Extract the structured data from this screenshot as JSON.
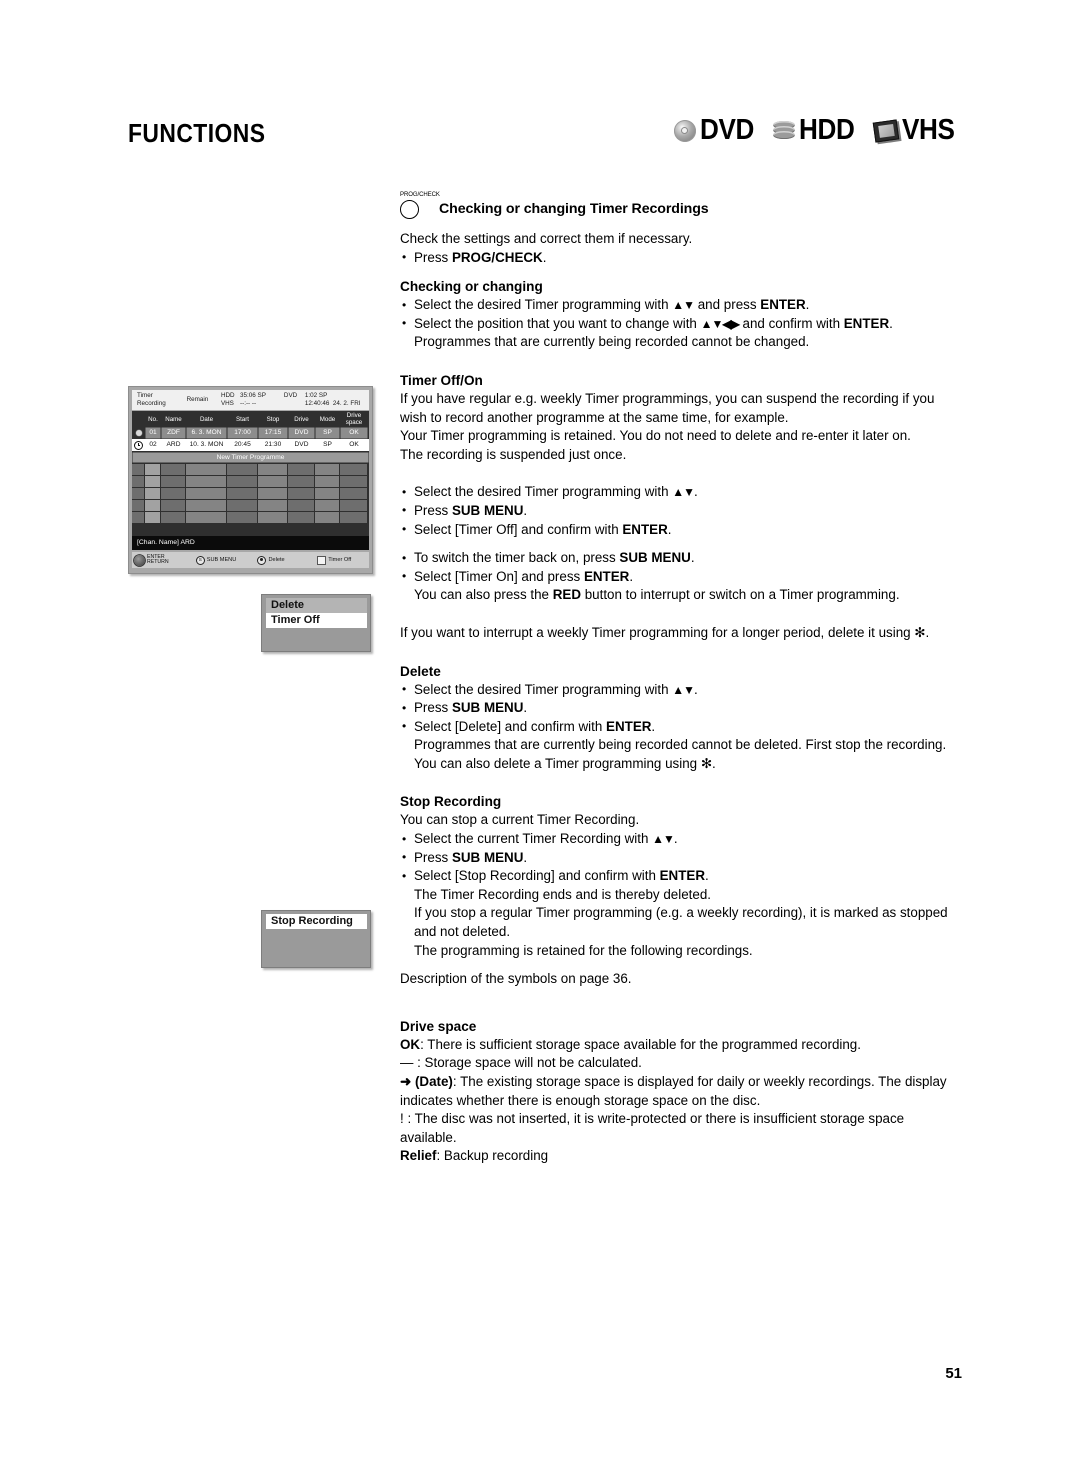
{
  "header": {
    "title": "FUNCTIONS",
    "media_badges": [
      {
        "icon": "disc-icon",
        "label": "DVD"
      },
      {
        "icon": "hdd-icon",
        "label": "HDD"
      },
      {
        "icon": "vhs-cassette-icon",
        "label": "VHS"
      }
    ]
  },
  "figure_timer_screen": {
    "top_bar": {
      "title_line1": "Timer",
      "title_line2": "Recording",
      "remain_label": "Remain",
      "hdd_label": "HDD",
      "hdd_value": "35:06 SP",
      "vhs_label": "VHS",
      "vhs_value": "--:--  --",
      "dvd_label": "DVD",
      "dvd_value": "1:02 SP",
      "clock": "12:40:46",
      "date": "24. 2. FRI"
    },
    "columns": [
      "",
      "No.",
      "Name",
      "Date",
      "Start",
      "Stop",
      "Drive",
      "Mode",
      "Drive space"
    ],
    "column_head_drive_space_line1": "Drive",
    "column_head_drive_space_line2": "space",
    "rows": [
      {
        "mark": "record-dot-icon",
        "no": "01",
        "name": "ZDF",
        "date": "6. 3. MON",
        "start": "17:00",
        "stop": "17:15",
        "drive": "DVD",
        "mode": "SP",
        "drive_space": "OK",
        "state": "selected"
      },
      {
        "mark": "clock-icon",
        "no": "02",
        "name": "ARD",
        "date": "10. 3. MON",
        "start": "20:45",
        "stop": "21:30",
        "drive": "DVD",
        "mode": "SP",
        "drive_space": "OK",
        "state": "normal"
      }
    ],
    "new_timer_programme": "New Timer Programme",
    "chan_name_bar": "[Chan. Name] ARD",
    "footer": {
      "enter": "ENTER",
      "return": "RETURN",
      "sub_menu": "SUB MENU",
      "sub_menu_key": "S",
      "delete": "Delete",
      "timer_off": "Timer Off"
    }
  },
  "popup_sub_menu_1": {
    "items": [
      {
        "label": "Delete",
        "highlight": "gray"
      },
      {
        "label": "Timer Off",
        "highlight": "white"
      }
    ]
  },
  "popup_sub_menu_2": {
    "items": [
      {
        "label": "Stop Recording",
        "highlight": "white"
      }
    ]
  },
  "content": {
    "button_glyph_label": "PROG/CHECK",
    "section_heading": "Checking or changing Timer Recordings",
    "intro_line": "Check the settings and correct them if necessary.",
    "intro_bullet_pre": "Press ",
    "intro_bullet_strong": "PROG/CHECK",
    "intro_bullet_post": ".",
    "checking_or_changing": {
      "heading": "Checking or changing",
      "b1_pre": "Select the desired Timer programming with ",
      "b1_arrows": "▲▼",
      "b1_mid": " and press ",
      "b1_strong": "ENTER",
      "b1_post": ".",
      "b2_pre": "Select the position that you want to change with ",
      "b2_arrows": "▲▼◀▶",
      "b2_mid": " and confirm with ",
      "b2_strong": "ENTER",
      "b2_post": ".",
      "b2_cont": "Programmes that are currently being recorded cannot be changed."
    },
    "timer_off_on": {
      "heading": "Timer Off/On",
      "p1": "If you have regular e.g. weekly Timer programmings, you can suspend the recording if you wish to record another programme at the same time, for example.",
      "p2": "Your Timer programming is retained. You do not need to delete and re-enter it later on.",
      "p3": "The recording is suspended just once.",
      "b1_pre": "Select the desired Timer programming with ",
      "b1_arrows": "▲▼",
      "b1_post": ".",
      "b2_pre": "Press ",
      "b2_strong": "SUB MENU",
      "b2_post": ".",
      "b3_pre": "Select [Timer Off] and confirm with ",
      "b3_strong": "ENTER",
      "b3_post": ".",
      "b4_pre": "To switch the timer back on, press ",
      "b4_strong": "SUB MENU",
      "b4_post": ".",
      "b5_pre": "Select [Timer On] and press ",
      "b5_strong": "ENTER",
      "b5_post": ".",
      "b5_cont_pre": "You can also press the ",
      "b5_cont_strong": "RED",
      "b5_cont_post": " button to interrupt or switch on a Timer programming.",
      "p4": "If you want to interrupt a weekly Timer programming for a longer period, delete it using ✻."
    },
    "delete": {
      "heading": "Delete",
      "b1_pre": "Select the desired Timer programming with ",
      "b1_arrows": "▲▼",
      "b1_post": ".",
      "b2_pre": "Press ",
      "b2_strong": "SUB MENU",
      "b2_post": ".",
      "b3_pre": "Select [Delete] and confirm with ",
      "b3_strong": "ENTER",
      "b3_post": ".",
      "b3_cont1": "Programmes that are currently being recorded cannot be deleted. First stop the recording.",
      "b3_cont2": "You can also delete a Timer programming using ✻."
    },
    "stop_recording": {
      "heading": "Stop Recording",
      "p1": "You can stop a current Timer Recording.",
      "b1_pre": "Select the current Timer Recording with ",
      "b1_arrows": "▲▼",
      "b1_post": ".",
      "b2_pre": "Press ",
      "b2_strong": "SUB MENU",
      "b2_post": ".",
      "b3_pre": "Select [Stop Recording] and confirm with ",
      "b3_strong": "ENTER",
      "b3_post": ".",
      "b3_cont1": "The Timer Recording ends and is thereby deleted.",
      "b3_cont2": "If you stop a regular Timer programming (e.g. a weekly recording), it is marked as stopped and not deleted.",
      "b3_cont3": "The programming is retained for the following recordings.",
      "p2": "Description of the symbols on page 36."
    },
    "drive_space": {
      "heading": "Drive space",
      "l1_strong": "OK",
      "l1_post": ": There is sufficient storage space available for the programmed recording.",
      "l2": "— : Storage space will not be calculated.",
      "l3_arrow": "➜ ",
      "l3_strong": "(Date)",
      "l3_post": ": The existing storage space is displayed for daily or weekly recordings. The display indicates whether there is enough storage space on the disc.",
      "l4": " !  : The disc was not inserted, it is write-protected or there is insufficient storage space available.",
      "l5_strong": "Relief",
      "l5_post": ": Backup recording"
    }
  },
  "page_number": "51"
}
